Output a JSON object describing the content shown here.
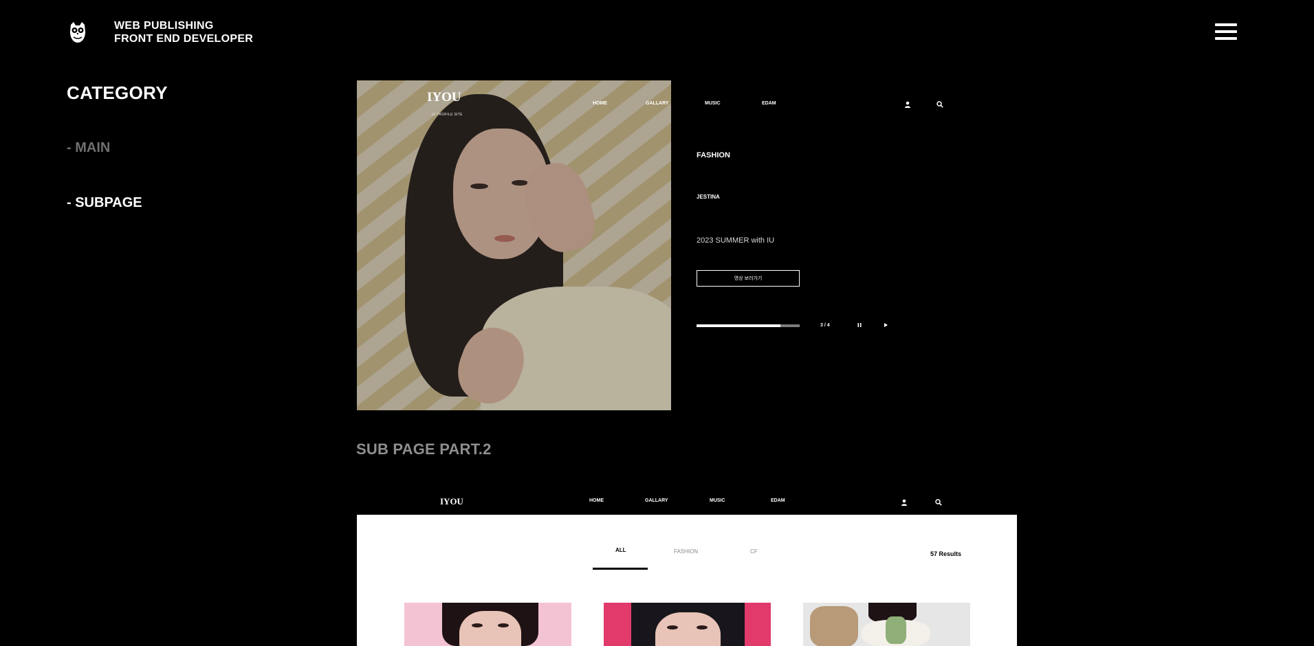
{
  "header": {
    "brand_line1": "WEB PUBLISHING",
    "brand_line2": "FRONT END DEVELOPER",
    "logo_icon": "owl-icon",
    "menu_icon": "hamburger-icon"
  },
  "sidebar": {
    "title": "CATEGORY",
    "items": [
      {
        "label": "- MAIN",
        "active": false
      },
      {
        "label": "- SUBPAGE",
        "active": true
      }
    ]
  },
  "preview1": {
    "logo": "IYOU",
    "logo_sub": "IU PROFILE SITE",
    "nav": [
      "HOME",
      "GALLARY",
      "MUSIC",
      "EDAM"
    ],
    "user_icon": "user-icon",
    "search_icon": "search-icon",
    "category": "FASHION",
    "brand": "JESTINA",
    "caption": "2023 SUMMER with IU",
    "button_label": "영상 보러가기",
    "slider": {
      "current": 3,
      "total": 4,
      "counter_text": "3 / 4",
      "progress": 0.81
    },
    "pause_icon": "pause-icon",
    "next_icon": "play-icon"
  },
  "section2": {
    "title": "SUB PAGE PART.2",
    "logo": "IYOU",
    "nav": [
      "HOME",
      "GALLARY",
      "MUSIC",
      "EDAM"
    ],
    "tabs": [
      "ALL",
      "FASHION",
      "CF"
    ],
    "active_tab": "ALL",
    "results": "57 Results"
  },
  "colors": {
    "background": "#000000",
    "muted_text": "#6f6f6f",
    "section_title": "#8e8e8e",
    "panel": "#ffffff"
  }
}
